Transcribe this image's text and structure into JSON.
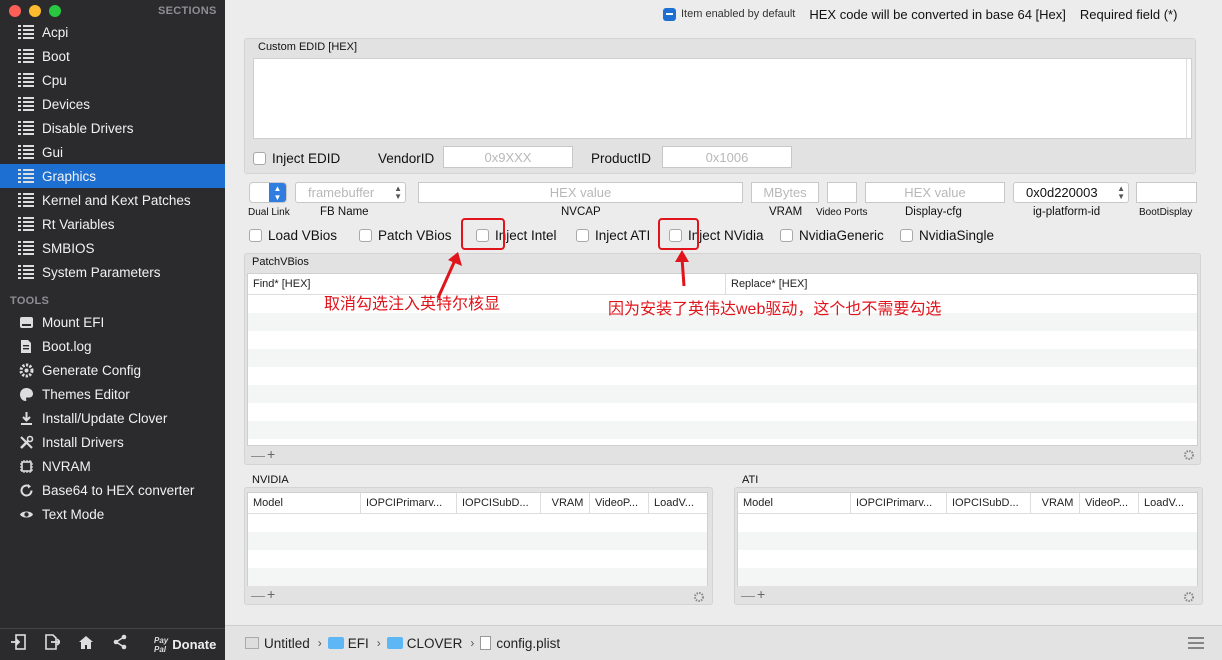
{
  "sidebar": {
    "sections_title": "SECTIONS",
    "items": [
      {
        "label": "Acpi"
      },
      {
        "label": "Boot"
      },
      {
        "label": "Cpu"
      },
      {
        "label": "Devices"
      },
      {
        "label": "Disable Drivers"
      },
      {
        "label": "Gui"
      },
      {
        "label": "Graphics"
      },
      {
        "label": "Kernel and Kext Patches"
      },
      {
        "label": "Rt Variables"
      },
      {
        "label": "SMBIOS"
      },
      {
        "label": "System Parameters"
      }
    ],
    "tools_title": "TOOLS",
    "tools": [
      {
        "label": "Mount EFI",
        "icon": "drive-icon"
      },
      {
        "label": "Boot.log",
        "icon": "document-icon"
      },
      {
        "label": "Generate Config",
        "icon": "gear-icon"
      },
      {
        "label": "Themes Editor",
        "icon": "palette-icon"
      },
      {
        "label": "Install/Update Clover",
        "icon": "download-icon"
      },
      {
        "label": "Install Drivers",
        "icon": "wrench-icon"
      },
      {
        "label": "NVRAM",
        "icon": "chip-icon"
      },
      {
        "label": "Base64 to HEX converter",
        "icon": "refresh-icon"
      },
      {
        "label": "Text Mode",
        "icon": "eye-icon"
      }
    ],
    "donate_label": "Donate",
    "paypal_label": "Pay Pal"
  },
  "status": {
    "enabled_default": "Item enabled by default",
    "hex_note": "HEX code will be converted in base 64 [Hex]",
    "required": "Required field (*)"
  },
  "edid": {
    "title": "Custom EDID [HEX]",
    "inject_label": "Inject EDID",
    "vendor_label": "VendorID",
    "vendor_placeholder": "0x9XXX",
    "product_label": "ProductID",
    "product_placeholder": "0x1006"
  },
  "graphics_row": {
    "framebuffer_placeholder": "framebuffer",
    "nvcap_placeholder": "HEX value",
    "vram_placeholder": "MBytes",
    "display_cfg_placeholder": "HEX value",
    "ig_platform_value": "0x0d220003",
    "labels": {
      "dual_link": "Dual Link",
      "fb_name": "FB Name",
      "nvcap": "NVCAP",
      "vram": "VRAM",
      "video_ports": "Video Ports",
      "display_cfg": "Display-cfg",
      "ig_platform": "ig-platform-id",
      "boot_display": "BootDisplay"
    }
  },
  "checkboxes": {
    "load_vbios": "Load VBios",
    "patch_vbios": "Patch VBios",
    "inject_intel": "Inject Intel",
    "inject_ati": "Inject ATI",
    "inject_nvidia": "Inject NVidia",
    "nvidia_generic": "NvidiaGeneric",
    "nvidia_single": "NvidiaSingle"
  },
  "patch_vbios": {
    "title": "PatchVBios",
    "col_find": "Find* [HEX]",
    "col_replace": "Replace* [HEX]"
  },
  "nvidia_table": {
    "title": "NVIDIA",
    "columns": [
      "Model",
      "IOPCIPrimarv...",
      "IOPCISubD...",
      "VRAM",
      "VideoP...",
      "LoadV..."
    ]
  },
  "ati_table": {
    "title": "ATI",
    "columns": [
      "Model",
      "IOPCIPrimarv...",
      "IOPCISubD...",
      "VRAM",
      "VideoP...",
      "LoadV..."
    ]
  },
  "annotations": {
    "intel_note": "取消勾选注入英特尔核显",
    "nvidia_note": "因为安装了英伟达web驱动，这个也不需要勾选"
  },
  "footer": {
    "crumbs": [
      "Untitled",
      "EFI",
      "CLOVER",
      "config.plist"
    ]
  },
  "colors": {
    "accent": "#1d6fd1",
    "annotation_red": "#e0141b",
    "sidebar_bg": "#2b2b2d"
  }
}
